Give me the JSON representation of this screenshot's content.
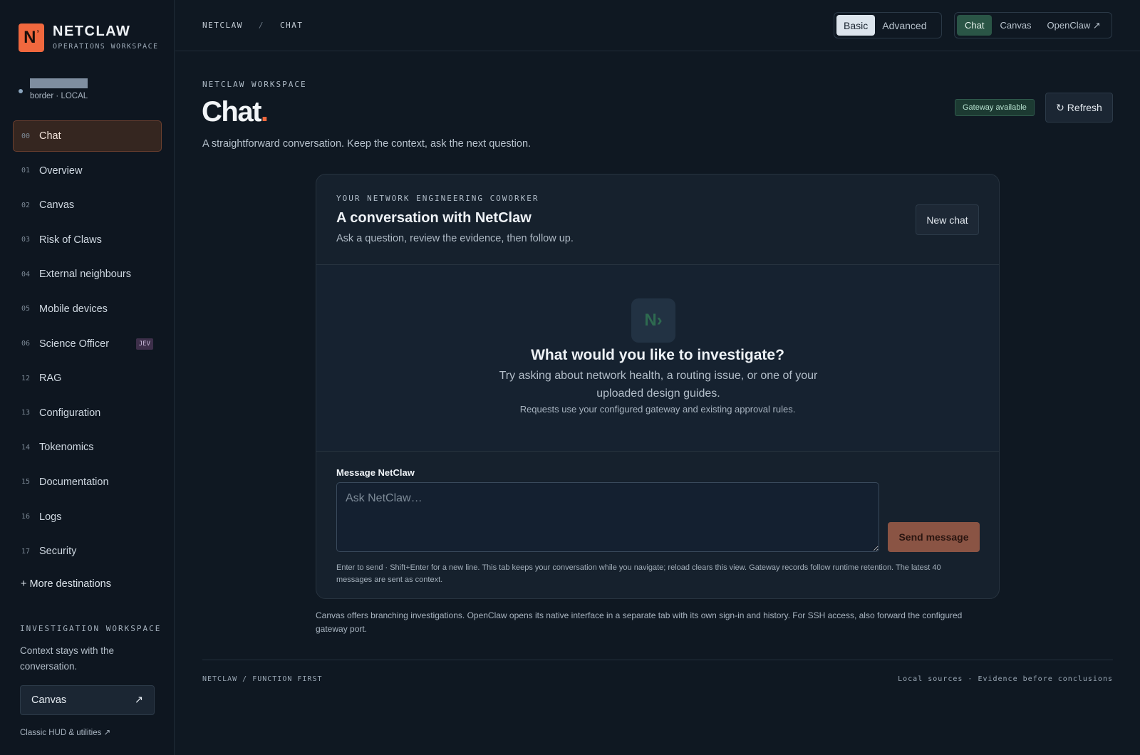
{
  "brand": {
    "logo": "N",
    "logo_mark": "’",
    "name": "NETCLAW",
    "subtitle": "OPERATIONS WORKSPACE"
  },
  "user": {
    "meta": "border · LOCAL"
  },
  "nav": {
    "items": [
      {
        "num": "00",
        "label": "Chat",
        "active": true
      },
      {
        "num": "01",
        "label": "Overview"
      },
      {
        "num": "02",
        "label": "Canvas"
      },
      {
        "num": "03",
        "label": "Risk of Claws"
      },
      {
        "num": "04",
        "label": "External neighbours"
      },
      {
        "num": "05",
        "label": "Mobile devices"
      },
      {
        "num": "06",
        "label": "Science Officer",
        "badge": "JEV"
      },
      {
        "num": "12",
        "label": "RAG"
      },
      {
        "num": "13",
        "label": "Configuration"
      },
      {
        "num": "14",
        "label": "Tokenomics"
      },
      {
        "num": "15",
        "label": "Documentation"
      },
      {
        "num": "16",
        "label": "Logs"
      },
      {
        "num": "17",
        "label": "Security"
      }
    ],
    "more": "+ More destinations"
  },
  "investigation": {
    "title": "INVESTIGATION WORKSPACE",
    "text": "Context stays with the conversation.",
    "canvas_label": "Canvas",
    "canvas_arrow": "↗",
    "classic_link": "Classic HUD & utilities ↗"
  },
  "topbar": {
    "crumb_root": "NETCLAW",
    "crumb_sep": "/",
    "crumb_page": "CHAT",
    "mode": {
      "basic": "Basic",
      "advanced": "Advanced"
    },
    "views": {
      "chat": "Chat",
      "canvas": "Canvas",
      "openclaw": "OpenClaw ↗"
    }
  },
  "header": {
    "kicker": "NETCLAW WORKSPACE",
    "title": "Chat",
    "title_dot": ".",
    "subtitle": "A straightforward conversation. Keep the context, ask the next question.",
    "gateway_status": "Gateway available",
    "refresh_label": "↻ Refresh"
  },
  "card": {
    "kicker": "YOUR NETWORK ENGINEERING COWORKER",
    "title": "A conversation with NetClaw",
    "subtitle": "Ask a question, review the evidence, then follow up.",
    "new_chat": "New chat",
    "empty_icon": "N›",
    "empty_title": "What would you like to investigate?",
    "empty_text": "Try asking about network health, a routing issue, or one of your uploaded design guides.",
    "empty_note": "Requests use your configured gateway and existing approval rules.",
    "compose_label": "Message NetClaw",
    "compose_placeholder": "Ask NetClaw…",
    "send_label": "Send message",
    "compose_hint": "Enter to send · Shift+Enter for a new line. This tab keeps your conversation while you navigate; reload clears this view. Gateway records follow runtime retention. The latest 40 messages are sent as context."
  },
  "footnote": "Canvas offers branching investigations. OpenClaw opens its native interface in a separate tab with its own sign-in and history. For SSH access, also forward the configured gateway port.",
  "footer": {
    "left": "NETCLAW / FUNCTION FIRST",
    "right": "Local sources · Evidence before conclusions"
  },
  "colors": {
    "accent": "#f0683e",
    "active_view": "#2a5546",
    "send_button": "#8a5444"
  }
}
